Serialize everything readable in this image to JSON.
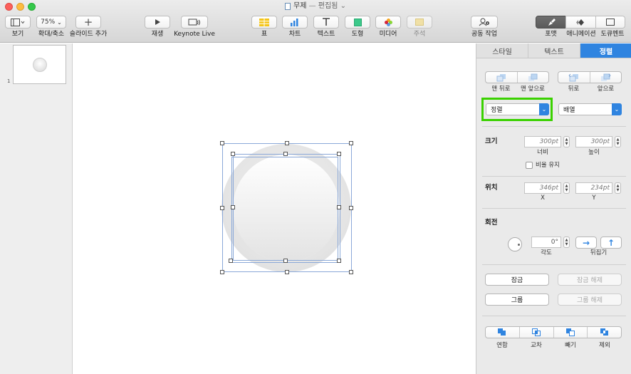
{
  "window": {
    "title": "무제",
    "subtitle": "편집됨"
  },
  "toolbar": {
    "view": "보기",
    "zoom_value": "75%",
    "zoom": "확대/축소",
    "add_slide": "슬라이드 추가",
    "play": "재생",
    "keynote_live": "Keynote Live",
    "table": "표",
    "chart": "차트",
    "text": "텍스트",
    "shape": "도형",
    "media": "미디어",
    "comment": "주석",
    "collaborate": "공동 작업",
    "format": "포맷",
    "animate": "애니메이션",
    "document": "도큐멘트"
  },
  "navigator": {
    "slide_number": "1"
  },
  "inspector": {
    "tabs": [
      "스타일",
      "텍스트",
      "정렬"
    ],
    "order_labels": [
      "맨 뒤로",
      "맨 앞으로",
      "뒤로",
      "앞으로"
    ],
    "align_select": "정렬",
    "distribute_select": "배열",
    "size": {
      "label": "크기",
      "width": "300pt",
      "height": "300pt",
      "width_label": "너비",
      "height_label": "높이",
      "constrain": "비율 유지"
    },
    "position": {
      "label": "위치",
      "x": "346pt",
      "y": "234pt",
      "x_label": "X",
      "y_label": "Y"
    },
    "rotate": {
      "label": "회전",
      "angle": "0°",
      "angle_label": "각도",
      "flip_label": "뒤집기"
    },
    "lock": "잠금",
    "unlock": "잠금 해제",
    "group": "그룹",
    "ungroup": "그룹 해제",
    "combine": [
      "연합",
      "교차",
      "빼기",
      "제외"
    ]
  },
  "colors": {
    "accent": "#2f84e0",
    "highlight": "#3ad100",
    "close": "#fc605c",
    "minimize": "#fdbc40",
    "zoom": "#34c84a"
  }
}
